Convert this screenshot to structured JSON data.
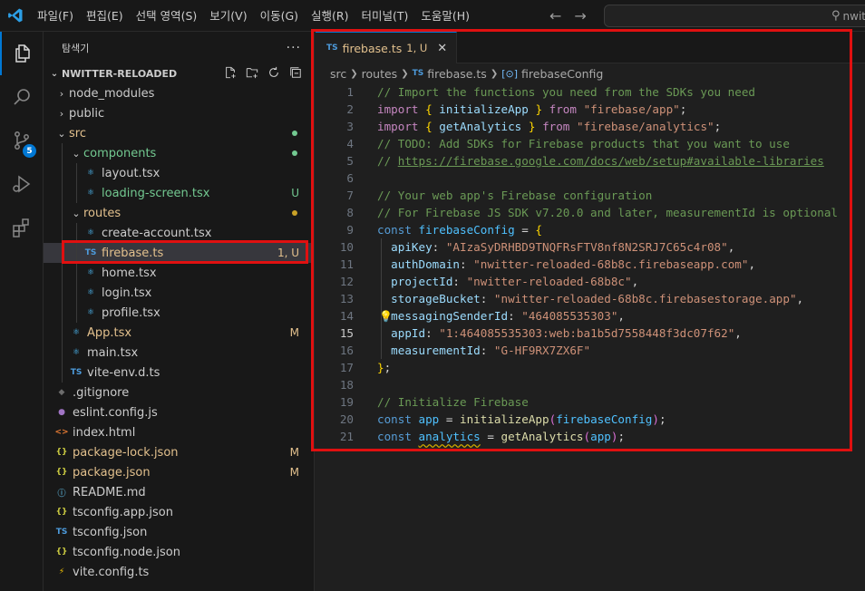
{
  "menu": [
    "파일(F)",
    "편집(E)",
    "선택 영역(S)",
    "보기(V)",
    "이동(G)",
    "실행(R)",
    "터미널(T)",
    "도움말(H)"
  ],
  "search": {
    "text": "nwitt"
  },
  "activity": {
    "scm_badge": "5"
  },
  "sidebar": {
    "title": "탐색기",
    "project": "NWITTER-RELOADED"
  },
  "tree": [
    {
      "label": "node_modules",
      "depth": 1,
      "type": "folder",
      "open": false,
      "color": "#cccccc",
      "icon": "",
      "iconColor": ""
    },
    {
      "label": "public",
      "depth": 1,
      "type": "folder",
      "open": false,
      "color": "#cccccc",
      "icon": "",
      "iconColor": ""
    },
    {
      "label": "src",
      "depth": 1,
      "type": "folder",
      "open": true,
      "color": "#e2c08d",
      "icon": "",
      "iconColor": "",
      "dot": "#73c991"
    },
    {
      "label": "components",
      "depth": 2,
      "type": "folder",
      "open": true,
      "color": "#73c991",
      "icon": "",
      "iconColor": "",
      "dot": "#73c991"
    },
    {
      "label": "layout.tsx",
      "depth": 3,
      "type": "file",
      "color": "#cccccc",
      "icon": "⚛",
      "iconColor": "#4fc1ff"
    },
    {
      "label": "loading-screen.tsx",
      "depth": 3,
      "type": "file",
      "color": "#73c991",
      "icon": "⚛",
      "iconColor": "#4fc1ff",
      "status": "U",
      "statusColor": "#73c991"
    },
    {
      "label": "routes",
      "depth": 2,
      "type": "folder",
      "open": true,
      "color": "#e2c08d",
      "icon": "",
      "iconColor": "",
      "dot": "#c9a227"
    },
    {
      "label": "create-account.tsx",
      "depth": 3,
      "type": "file",
      "color": "#cccccc",
      "icon": "⚛",
      "iconColor": "#4fc1ff"
    },
    {
      "label": "firebase.ts",
      "depth": 3,
      "type": "file",
      "color": "#e2c08d",
      "icon": "TS",
      "iconColor": "#4d9bdc",
      "status": "1, U",
      "statusColor": "#e2c08d",
      "selected": true
    },
    {
      "label": "home.tsx",
      "depth": 3,
      "type": "file",
      "color": "#cccccc",
      "icon": "⚛",
      "iconColor": "#4fc1ff"
    },
    {
      "label": "login.tsx",
      "depth": 3,
      "type": "file",
      "color": "#cccccc",
      "icon": "⚛",
      "iconColor": "#4fc1ff"
    },
    {
      "label": "profile.tsx",
      "depth": 3,
      "type": "file",
      "color": "#cccccc",
      "icon": "⚛",
      "iconColor": "#4fc1ff"
    },
    {
      "label": "App.tsx",
      "depth": 2,
      "type": "file",
      "color": "#e2c08d",
      "icon": "⚛",
      "iconColor": "#4fc1ff",
      "status": "M",
      "statusColor": "#e2c08d"
    },
    {
      "label": "main.tsx",
      "depth": 2,
      "type": "file",
      "color": "#cccccc",
      "icon": "⚛",
      "iconColor": "#4fc1ff"
    },
    {
      "label": "vite-env.d.ts",
      "depth": 2,
      "type": "file",
      "color": "#cccccc",
      "icon": "TS",
      "iconColor": "#4d9bdc"
    },
    {
      "label": ".gitignore",
      "depth": 1,
      "type": "file",
      "color": "#cccccc",
      "icon": "◆",
      "iconColor": "#6d6d6d"
    },
    {
      "label": "eslint.config.js",
      "depth": 1,
      "type": "file",
      "color": "#cccccc",
      "icon": "●",
      "iconColor": "#a074c4"
    },
    {
      "label": "index.html",
      "depth": 1,
      "type": "file",
      "color": "#cccccc",
      "icon": "<>",
      "iconColor": "#e37933"
    },
    {
      "label": "package-lock.json",
      "depth": 1,
      "type": "file",
      "color": "#e2c08d",
      "icon": "{}",
      "iconColor": "#cbcb41",
      "status": "M",
      "statusColor": "#e2c08d"
    },
    {
      "label": "package.json",
      "depth": 1,
      "type": "file",
      "color": "#e2c08d",
      "icon": "{}",
      "iconColor": "#cbcb41",
      "status": "M",
      "statusColor": "#e2c08d"
    },
    {
      "label": "README.md",
      "depth": 1,
      "type": "file",
      "color": "#cccccc",
      "icon": "ⓘ",
      "iconColor": "#519aba"
    },
    {
      "label": "tsconfig.app.json",
      "depth": 1,
      "type": "file",
      "color": "#cccccc",
      "icon": "{}",
      "iconColor": "#cbcb41"
    },
    {
      "label": "tsconfig.json",
      "depth": 1,
      "type": "file",
      "color": "#cccccc",
      "icon": "TS",
      "iconColor": "#4d9bdc"
    },
    {
      "label": "tsconfig.node.json",
      "depth": 1,
      "type": "file",
      "color": "#cccccc",
      "icon": "{}",
      "iconColor": "#cbcb41"
    },
    {
      "label": "vite.config.ts",
      "depth": 1,
      "type": "file",
      "color": "#cccccc",
      "icon": "⚡",
      "iconColor": "#ffcc00"
    }
  ],
  "tab": {
    "icon": "TS",
    "name": "firebase.ts",
    "status": "1, U"
  },
  "breadcrumbs": {
    "folder": "src",
    "sub": "routes",
    "file": "firebase.ts",
    "symbol": "firebaseConfig"
  },
  "editor": {
    "current_line": 15
  },
  "code": [
    [
      [
        "com",
        "// Import the functions you need from the SDKs you need"
      ]
    ],
    [
      [
        "kw",
        "import"
      ],
      [
        "punc",
        " "
      ],
      [
        "br1",
        "{"
      ],
      [
        "punc",
        " "
      ],
      [
        "var",
        "initializeApp"
      ],
      [
        "punc",
        " "
      ],
      [
        "br1",
        "}"
      ],
      [
        "punc",
        " "
      ],
      [
        "kw",
        "from"
      ],
      [
        "punc",
        " "
      ],
      [
        "str",
        "\"firebase/app\""
      ],
      [
        "punc",
        ";"
      ]
    ],
    [
      [
        "kw",
        "import"
      ],
      [
        "punc",
        " "
      ],
      [
        "br1",
        "{"
      ],
      [
        "punc",
        " "
      ],
      [
        "var",
        "getAnalytics"
      ],
      [
        "punc",
        " "
      ],
      [
        "br1",
        "}"
      ],
      [
        "punc",
        " "
      ],
      [
        "kw",
        "from"
      ],
      [
        "punc",
        " "
      ],
      [
        "str",
        "\"firebase/analytics\""
      ],
      [
        "punc",
        ";"
      ]
    ],
    [
      [
        "com",
        "// TODO: Add SDKs for Firebase products that you want to use"
      ]
    ],
    [
      [
        "com",
        "// "
      ],
      [
        "link",
        "https://firebase.google.com/docs/web/setup#available-libraries"
      ]
    ],
    [],
    [
      [
        "com",
        "// Your web app's Firebase configuration"
      ]
    ],
    [
      [
        "com",
        "// For Firebase JS SDK v7.20.0 and later, measurementId is optional"
      ]
    ],
    [
      [
        "dec",
        "const"
      ],
      [
        "punc",
        " "
      ],
      [
        "const",
        "firebaseConfig"
      ],
      [
        "punc",
        " = "
      ],
      [
        "br1",
        "{"
      ]
    ],
    [
      [
        "punc",
        "  "
      ],
      [
        "var",
        "apiKey"
      ],
      [
        "punc",
        ": "
      ],
      [
        "str",
        "\"AIzaSyDRHBD9TNQFRsFTV8nf8N2SRJ7C65c4r08\""
      ],
      [
        "punc",
        ","
      ]
    ],
    [
      [
        "punc",
        "  "
      ],
      [
        "var",
        "authDomain"
      ],
      [
        "punc",
        ": "
      ],
      [
        "str",
        "\"nwitter-reloaded-68b8c.firebaseapp.com\""
      ],
      [
        "punc",
        ","
      ]
    ],
    [
      [
        "punc",
        "  "
      ],
      [
        "var",
        "projectId"
      ],
      [
        "punc",
        ": "
      ],
      [
        "str",
        "\"nwitter-reloaded-68b8c\""
      ],
      [
        "punc",
        ","
      ]
    ],
    [
      [
        "punc",
        "  "
      ],
      [
        "var",
        "storageBucket"
      ],
      [
        "punc",
        ": "
      ],
      [
        "str",
        "\"nwitter-reloaded-68b8c.firebasestorage.app\""
      ],
      [
        "punc",
        ","
      ]
    ],
    [
      [
        "punc",
        "  "
      ],
      [
        "var",
        "messagingSenderId"
      ],
      [
        "punc",
        ": "
      ],
      [
        "str",
        "\"464085535303\""
      ],
      [
        "punc",
        ","
      ]
    ],
    [
      [
        "punc",
        "  "
      ],
      [
        "var",
        "appId"
      ],
      [
        "punc",
        ": "
      ],
      [
        "str",
        "\"1:464085535303:web:ba1b5d7558448f3dc07f62\""
      ],
      [
        "punc",
        ","
      ]
    ],
    [
      [
        "punc",
        "  "
      ],
      [
        "var",
        "measurementId"
      ],
      [
        "punc",
        ": "
      ],
      [
        "str",
        "\"G-HF9RX7ZX6F\""
      ]
    ],
    [
      [
        "br1",
        "}"
      ],
      [
        "punc",
        ";"
      ]
    ],
    [],
    [
      [
        "com",
        "// Initialize Firebase"
      ]
    ],
    [
      [
        "dec",
        "const"
      ],
      [
        "punc",
        " "
      ],
      [
        "const",
        "app"
      ],
      [
        "punc",
        " = "
      ],
      [
        "fn",
        "initializeApp"
      ],
      [
        "br2",
        "("
      ],
      [
        "const",
        "firebaseConfig"
      ],
      [
        "br2",
        ")"
      ],
      [
        "punc",
        ";"
      ]
    ],
    [
      [
        "dec",
        "const"
      ],
      [
        "punc",
        " "
      ],
      [
        "const squiggle",
        "analytics"
      ],
      [
        "punc",
        " = "
      ],
      [
        "fn",
        "getAnalytics"
      ],
      [
        "br2",
        "("
      ],
      [
        "const",
        "app"
      ],
      [
        "br2",
        ")"
      ],
      [
        "punc",
        ";"
      ]
    ]
  ]
}
